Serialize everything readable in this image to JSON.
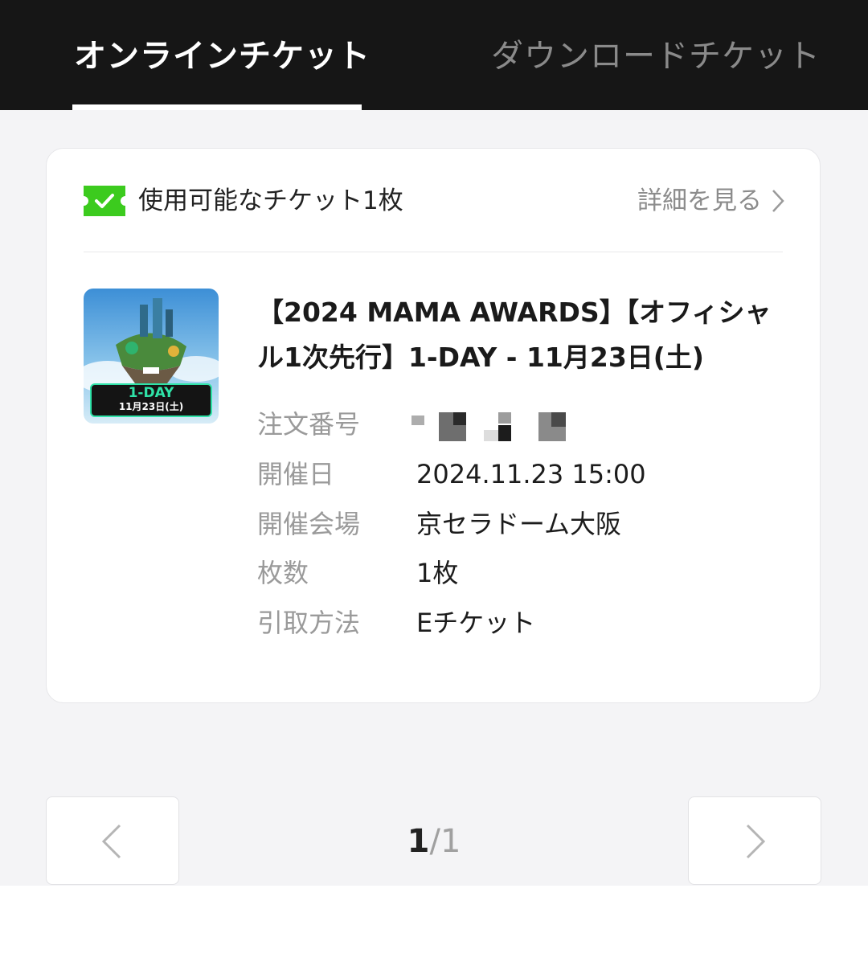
{
  "tabs": {
    "online": "オンラインチケット",
    "download": "ダウンロードチケット"
  },
  "card": {
    "available_text": "使用可能なチケット1枚",
    "detail_link": "詳細を見る",
    "poster": {
      "line1": "1-DAY",
      "line2": "11月23日(土)"
    },
    "event_title": "【2024 MAMA AWARDS】【オフィシャル1次先行】1-DAY - 11月23日(土)",
    "info": [
      {
        "label": "注文番号",
        "value": ""
      },
      {
        "label": "開催日",
        "value": "2024.11.23 15:00"
      },
      {
        "label": "開催会場",
        "value": "京セラドーム大阪"
      },
      {
        "label": "枚数",
        "value": "1枚"
      },
      {
        "label": "引取方法",
        "value": "Eチケット"
      }
    ]
  },
  "pager": {
    "current": "1",
    "separator": "/",
    "total": "1"
  },
  "icons": {
    "ticket": "ticket-check-icon",
    "detail_chevron": "chevron-right-icon",
    "prev": "chevron-left-icon",
    "next": "chevron-right-icon"
  },
  "colors": {
    "tabbar_bg": "#161616",
    "accent_green": "#3ccb1e",
    "content_bg": "#f4f4f6"
  }
}
